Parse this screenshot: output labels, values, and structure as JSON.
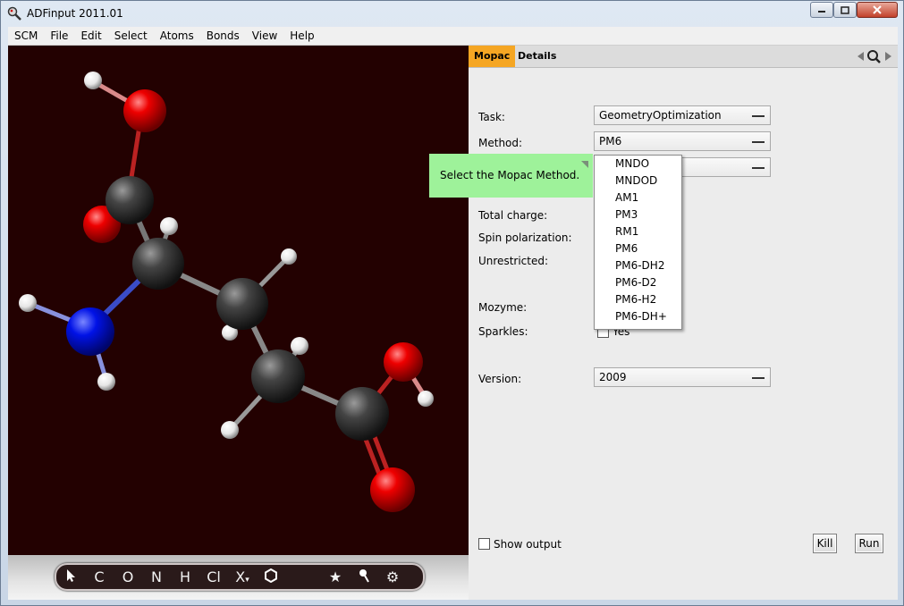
{
  "window": {
    "title": "ADFinput 2011.01"
  },
  "menu": [
    "SCM",
    "File",
    "Edit",
    "Select",
    "Atoms",
    "Bonds",
    "View",
    "Help"
  ],
  "tabs": {
    "active": "Mopac",
    "other": "Details"
  },
  "form": {
    "task_label": "Task:",
    "task_value": "GeometryOptimization",
    "method_label": "Method:",
    "method_value": "PM6",
    "total_charge_label": "Total charge:",
    "spin_polarization_label": "Spin polarization:",
    "unrestricted_label": "Unrestricted:",
    "mozyme_label": "Mozyme:",
    "sparkles_label": "Sparkles:",
    "sparkles_value": "Yes",
    "version_label": "Version:",
    "version_value": "2009"
  },
  "tooltip": "Select the Mopac Method.",
  "method_options": [
    "MNDO",
    "MNDOD",
    "AM1",
    "PM3",
    "RM1",
    "PM6",
    "PM6-DH2",
    "PM6-D2",
    "PM6-H2",
    "PM6-DH+"
  ],
  "bottom": {
    "show_output_label": "Show output",
    "kill_label": "Kill",
    "run_label": "Run"
  },
  "toolbar_tools": [
    "pointer",
    "C",
    "O",
    "N",
    "H",
    "Cl",
    "X",
    "ring",
    "star",
    "pin",
    "gear"
  ],
  "toolbar_text": {
    "c": "C",
    "o": "O",
    "n": "N",
    "h": "H",
    "cl": "Cl",
    "x": "X"
  },
  "colors": {
    "viewer_bg": "#230101",
    "active_tab": "#f5a623",
    "tooltip_bg": "#9ef29a",
    "oxygen": "#e00000",
    "nitrogen": "#0010e0",
    "carbon": "#3a3a3a",
    "hydrogen": "#f0f0f0"
  }
}
